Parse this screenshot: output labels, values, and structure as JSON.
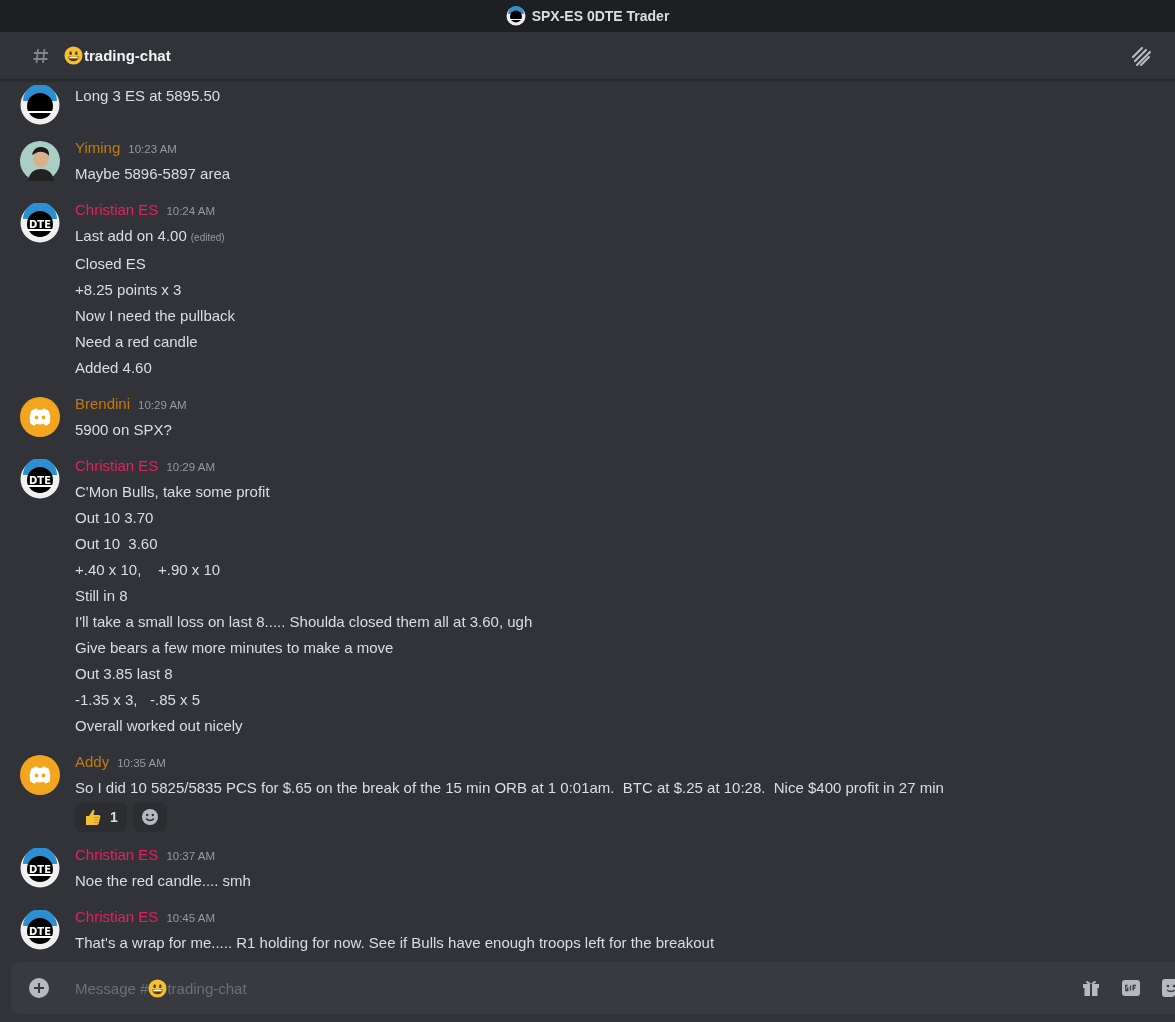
{
  "window": {
    "title": "SPX-ES 0DTE Trader"
  },
  "channel": {
    "name": "trading-chat"
  },
  "messages": [
    {
      "kind": "dte",
      "lines": [
        {
          "text": "Long 3 ES at 5895.50"
        }
      ]
    },
    {
      "kind": "person",
      "author": "Yiming",
      "color": "#c27c0e",
      "time": "10:23 AM",
      "lines": [
        {
          "text": "Maybe 5896-5897 area"
        }
      ]
    },
    {
      "kind": "dte",
      "avatar_text": "DTE",
      "author": "Christian ES",
      "color": "#e0245e",
      "time": "10:24 AM",
      "lines": [
        {
          "text": "Last add on 4.00",
          "edited_label": "(edited)"
        },
        {
          "text": "Closed ES"
        },
        {
          "text": "+8.25 points x 3"
        },
        {
          "text": "Now I need the pullback"
        },
        {
          "text": "Need a red candle"
        },
        {
          "text": "Added 4.60"
        }
      ]
    },
    {
      "kind": "discord",
      "author": "Brendini",
      "color": "#c27c0e",
      "time": "10:29 AM",
      "lines": [
        {
          "text": "5900 on SPX?"
        }
      ]
    },
    {
      "kind": "dte",
      "avatar_text": "DTE",
      "author": "Christian ES",
      "color": "#e0245e",
      "time": "10:29 AM",
      "lines": [
        {
          "text": "C'Mon Bulls, take some profit"
        },
        {
          "text": "Out 10 3.70"
        },
        {
          "text": "Out 10  3.60"
        },
        {
          "text": "+.40 x 10,    +.90 x 10"
        },
        {
          "text": "Still in 8"
        },
        {
          "text": "I'll take a small loss on last 8..... Shoulda closed them all at 3.60, ugh"
        },
        {
          "text": "Give bears a few more minutes to make a move"
        },
        {
          "text": "Out 3.85 last 8"
        },
        {
          "text": "-1.35 x 3,   -.85 x 5"
        },
        {
          "text": "Overall worked out nicely"
        }
      ]
    },
    {
      "kind": "discord",
      "author": "Addy",
      "color": "#c27c0e",
      "time": "10:35 AM",
      "lines": [
        {
          "text": "So I did 10 5825/5835 PCS for $.65 on the break of the 15 min ORB at 1 0:01am.  BTC at $.25 at 10:28.  Nice $400 profit in 27 min"
        }
      ],
      "reactions": [
        {
          "count": "1",
          "selected": false
        }
      ]
    },
    {
      "kind": "dte",
      "avatar_text": "DTE",
      "author": "Christian ES",
      "color": "#e0245e",
      "time": "10:37 AM",
      "lines": [
        {
          "text": "Noe the red candle.... smh"
        }
      ]
    },
    {
      "kind": "dte",
      "avatar_text": "DTE",
      "author": "Christian ES",
      "color": "#e0245e",
      "time": "10:45 AM",
      "lines": [
        {
          "text": "That's a wrap for me..... R1 holding for now. See if Bulls have enough troops left for the breakout"
        }
      ]
    }
  ],
  "composer": {
    "prefix": "Message #",
    "channel": "trading-chat"
  }
}
